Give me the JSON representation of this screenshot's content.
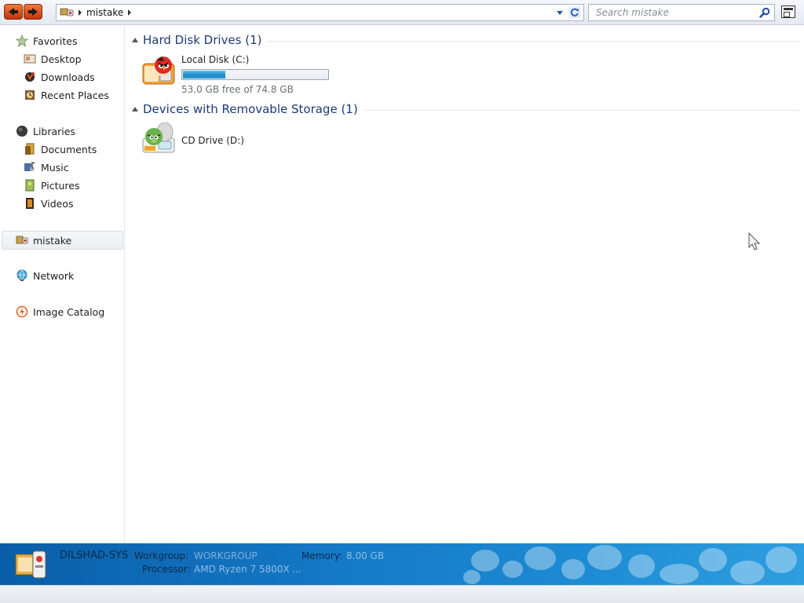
{
  "address_bar": {
    "crumbs": [
      "mistake"
    ],
    "search_placeholder": "Search mistake"
  },
  "sidebar": {
    "favorites": {
      "label": "Favorites",
      "items": [
        {
          "label": "Desktop",
          "icon": "desktop-icon"
        },
        {
          "label": "Downloads",
          "icon": "downloads-icon"
        },
        {
          "label": "Recent Places",
          "icon": "recent-places-icon"
        }
      ]
    },
    "libraries": {
      "label": "Libraries",
      "items": [
        {
          "label": "Documents",
          "icon": "documents-icon"
        },
        {
          "label": "Music",
          "icon": "music-icon"
        },
        {
          "label": "Pictures",
          "icon": "pictures-icon"
        },
        {
          "label": "Videos",
          "icon": "videos-icon"
        }
      ]
    },
    "computer": {
      "label": "mistake",
      "selected": true
    },
    "network": {
      "label": "Network"
    },
    "image_catalog": {
      "label": "Image Catalog"
    }
  },
  "content": {
    "groups": [
      {
        "title": "Hard Disk Drives (1)",
        "items": [
          {
            "name": "Local Disk (C:)",
            "size_text": "53.0 GB free of 74.8 GB",
            "used_fraction": 0.29
          }
        ]
      },
      {
        "title": "Devices with Removable Storage (1)",
        "items": [
          {
            "name": "CD Drive (D:)"
          }
        ]
      }
    ]
  },
  "details_pane": {
    "computer_name": "DILSHAD-SYS",
    "workgroup_label": "Workgroup:",
    "workgroup_value": "WORKGROUP",
    "memory_label": "Memory:",
    "memory_value": "8.00 GB",
    "processor_label": "Processor:",
    "processor_value": "AMD Ryzen 7 5800X ..."
  },
  "colors": {
    "accent": "#1d3a73",
    "progress_fill": "#1e8bc7",
    "details_background": "#1478c5",
    "nav_button": "#d9531e"
  }
}
